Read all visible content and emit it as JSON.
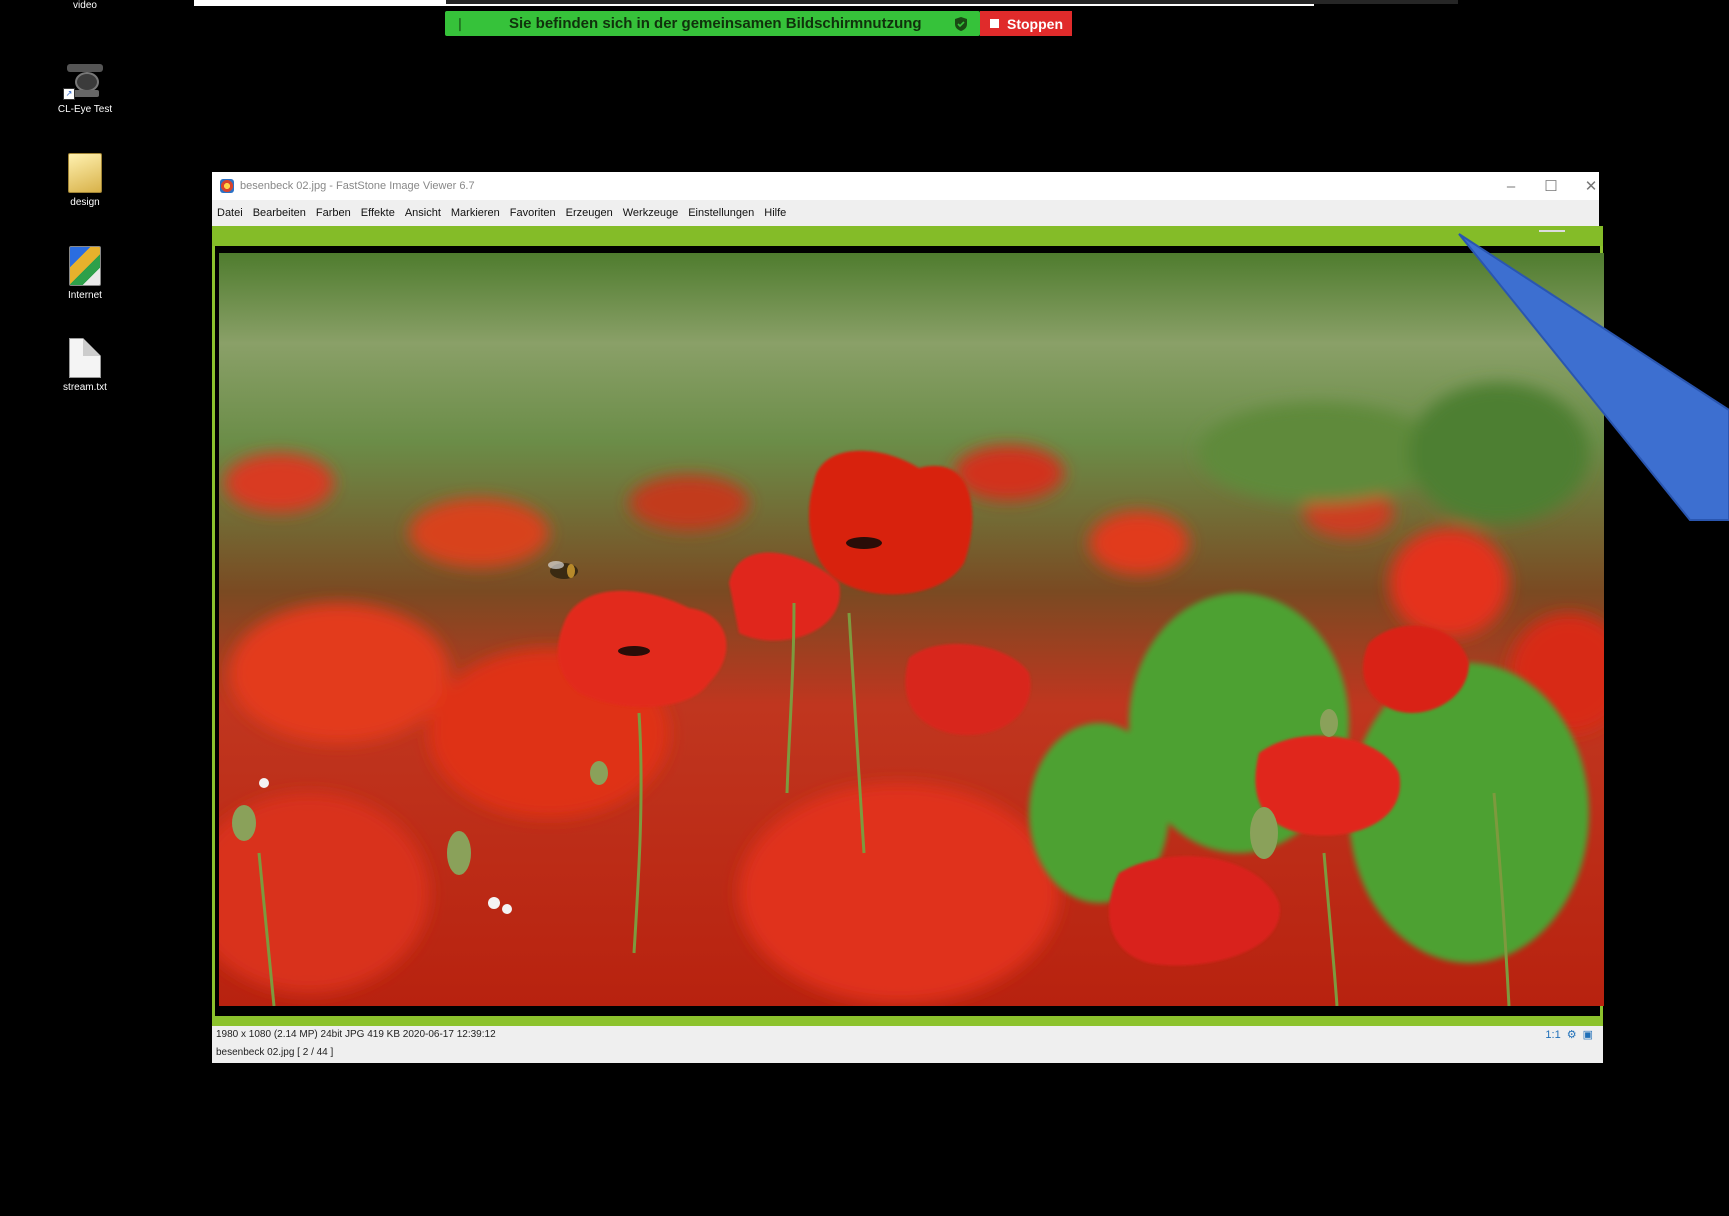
{
  "desktop": {
    "icons": [
      {
        "label": "video",
        "icon": "video-icon"
      },
      {
        "label": "CL-Eye Test",
        "icon": "webcam-icon"
      },
      {
        "label": "design",
        "icon": "folder-icon"
      },
      {
        "label": "Internet",
        "icon": "internet-shortcut-icon"
      },
      {
        "label": "stream.txt",
        "icon": "text-file-icon"
      }
    ]
  },
  "share_banner": {
    "message": "Sie befinden sich in der gemeinsamen Bildschirmnutzung",
    "stop_label": "Stoppen",
    "color": "#36c23a",
    "stop_color": "#e02b2b"
  },
  "window": {
    "title": "besenbeck 02.jpg  -  FastStone Image Viewer 6.7",
    "menu": [
      "Datei",
      "Bearbeiten",
      "Farben",
      "Effekte",
      "Ansicht",
      "Markieren",
      "Favoriten",
      "Erzeugen",
      "Werkzeuge",
      "Einstellungen",
      "Hilfe"
    ],
    "controls": {
      "minimize": "–",
      "maximize": "☐",
      "close": "✕"
    },
    "accent_color": "#84bc28"
  },
  "status": {
    "image_info": "1980 x 1080 (2.14 MP)  24bit  JPG   419 KB   2020-06-17 12:39:12",
    "file_position": "besenbeck 02.jpg [ 2 / 44 ]",
    "zoom": "1:1"
  },
  "annotation": {
    "color": "#3d6fd0"
  }
}
